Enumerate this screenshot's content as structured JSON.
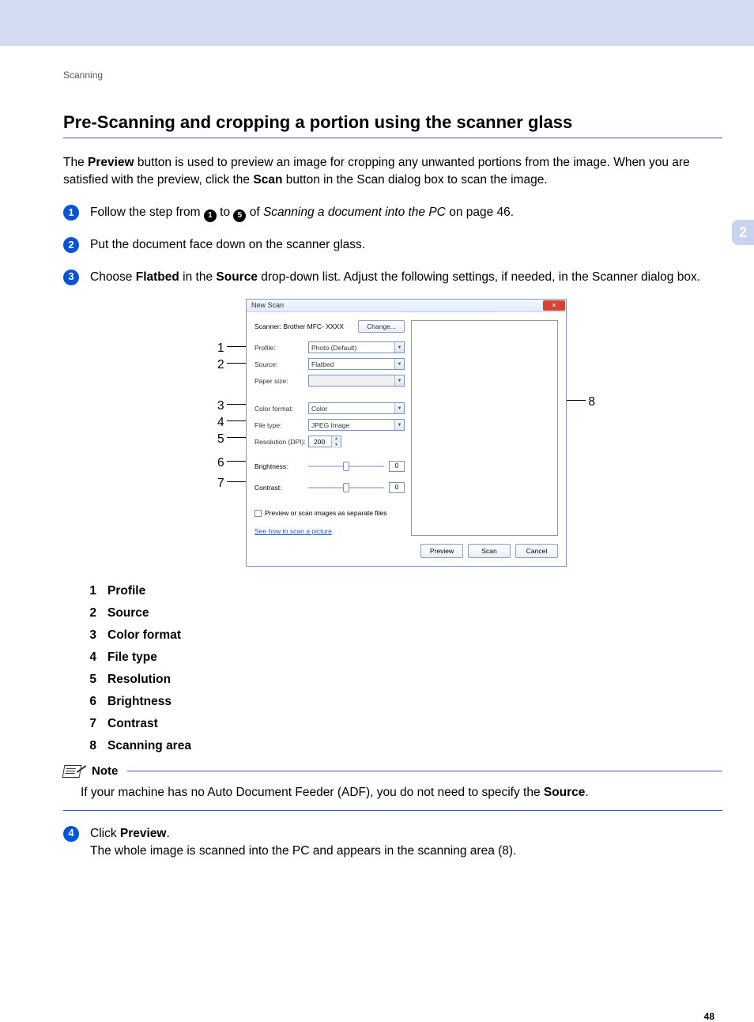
{
  "header": {
    "breadcrumb": "Scanning"
  },
  "title": "Pre-Scanning and cropping a portion using the scanner glass",
  "intro": {
    "prefix": "The ",
    "b1": "Preview",
    "mid1": " button is used to preview an image for cropping any unwanted portions from the image. When you are satisfied with the preview, click the ",
    "b2": "Scan",
    "suffix": " button in the Scan dialog box to scan the image."
  },
  "side_tab": "2",
  "steps": {
    "s1": {
      "t1": "Follow the step from ",
      "circ1": "1",
      "t2": " to ",
      "circ2": "5",
      "t3": " of ",
      "italic": "Scanning a document into the PC",
      "t4": " on page 46."
    },
    "s2": "Put the document face down on the scanner glass.",
    "s3": {
      "t1": "Choose ",
      "b1": "Flatbed",
      "t2": " in the ",
      "b2": "Source",
      "t3": " drop-down list. Adjust the following settings, if needed, in the Scanner dialog box."
    },
    "s4": {
      "t1": "Click ",
      "b1": "Preview",
      "t2": ".",
      "line2": "The whole image is scanned into the PC and appears in the scanning area (8)."
    }
  },
  "dialog": {
    "title": "New Scan",
    "scanner_label": "Scanner: Brother MFC- XXXX",
    "change_btn": "Change...",
    "labels": {
      "profile": "Profile:",
      "source": "Source:",
      "papersize": "Paper size:",
      "colorformat": "Color format:",
      "filetype": "File type:",
      "resolution": "Resolution (DPI):",
      "brightness": "Brightness:",
      "contrast": "Contrast:"
    },
    "values": {
      "profile": "Photo (Default)",
      "source": "Flatbed",
      "papersize": "",
      "colorformat": "Color",
      "filetype": "JPEG Image",
      "resolution": "200",
      "brightness": "0",
      "contrast": "0"
    },
    "checkbox": "Preview or scan images as separate files",
    "helplink": "See how to scan a picture",
    "buttons": {
      "preview": "Preview",
      "scan": "Scan",
      "cancel": "Cancel"
    }
  },
  "callouts": {
    "c1": "1",
    "c2": "2",
    "c3": "3",
    "c4": "4",
    "c5": "5",
    "c6": "6",
    "c7": "7",
    "c8": "8"
  },
  "legend": {
    "r1": {
      "n": "1",
      "t": "Profile"
    },
    "r2": {
      "n": "2",
      "t": "Source"
    },
    "r3": {
      "n": "3",
      "t": "Color format"
    },
    "r4": {
      "n": "4",
      "t": "File type"
    },
    "r5": {
      "n": "5",
      "t": "Resolution"
    },
    "r6": {
      "n": "6",
      "t": "Brightness"
    },
    "r7": {
      "n": "7",
      "t": "Contrast"
    },
    "r8": {
      "n": "8",
      "t": "Scanning area"
    }
  },
  "note": {
    "label": "Note",
    "body_prefix": "If your machine has no Auto Document Feeder (ADF), you do not need to specify the ",
    "body_bold": "Source",
    "body_suffix": "."
  },
  "page_number": "48"
}
